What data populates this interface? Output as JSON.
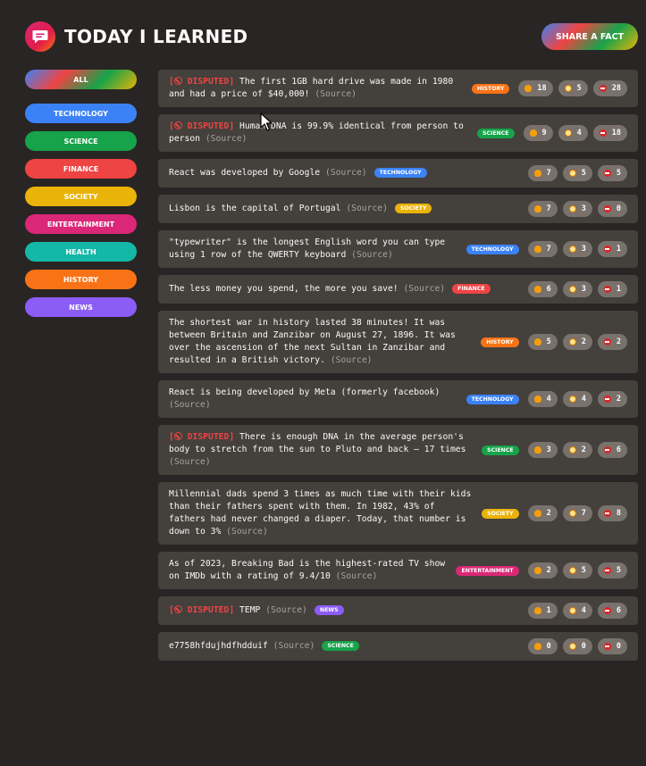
{
  "header": {
    "title": "Today I Learned",
    "share_label": "Share a fact",
    "logo_icon": "speech-bubble-icon"
  },
  "colors": {
    "background": "#292524",
    "card": "#44403c",
    "vote_button": "#78716c",
    "disputed": "#ef4444"
  },
  "categories": [
    {
      "id": "all",
      "label": "All",
      "color": "gradient"
    },
    {
      "id": "technology",
      "label": "Technology",
      "color": "#3b82f6"
    },
    {
      "id": "science",
      "label": "Science",
      "color": "#16a34a"
    },
    {
      "id": "finance",
      "label": "Finance",
      "color": "#ef4444"
    },
    {
      "id": "society",
      "label": "Society",
      "color": "#eab308"
    },
    {
      "id": "entertainment",
      "label": "Entertainment",
      "color": "#db2777"
    },
    {
      "id": "health",
      "label": "Health",
      "color": "#14b8a6"
    },
    {
      "id": "history",
      "label": "History",
      "color": "#f97316"
    },
    {
      "id": "news",
      "label": "News",
      "color": "#8b5cf6"
    }
  ],
  "disputed_label": "DISPUTED",
  "source_label": "(Source)",
  "vote_icons": [
    "thumbs-up-icon",
    "mind-blown-icon",
    "no-entry-icon"
  ],
  "facts": [
    {
      "disputed": true,
      "text": "The first 1GB hard drive was made in 1980 and had a price of $40,000!",
      "category": "history",
      "tag_inline": false,
      "votes": [
        18,
        5,
        28
      ]
    },
    {
      "disputed": true,
      "text": "Human DNA is 99.9% identical from person to person",
      "category": "science",
      "tag_inline": false,
      "votes": [
        9,
        4,
        18
      ]
    },
    {
      "disputed": false,
      "text": "React was developed by Google",
      "category": "technology",
      "tag_inline": true,
      "votes": [
        7,
        5,
        5
      ]
    },
    {
      "disputed": false,
      "text": "Lisbon is the capital of Portugal",
      "category": "society",
      "tag_inline": true,
      "votes": [
        7,
        3,
        0
      ]
    },
    {
      "disputed": false,
      "text": "\"typewriter\" is the longest English word you can type using 1 row of the QWERTY keyboard",
      "category": "technology",
      "tag_inline": false,
      "votes": [
        7,
        3,
        1
      ]
    },
    {
      "disputed": false,
      "text": "The less money you spend, the more you save!",
      "category": "finance",
      "tag_inline": true,
      "votes": [
        6,
        3,
        1
      ]
    },
    {
      "disputed": false,
      "text": "The shortest war in history lasted 38 minutes! It was between Britain and Zanzibar on August 27, 1896. It was over the ascension of the next Sultan in Zanzibar and resulted in a British victory.",
      "category": "history",
      "tag_inline": false,
      "votes": [
        5,
        2,
        2
      ]
    },
    {
      "disputed": false,
      "text": "React is being developed by Meta (formerly facebook)",
      "category": "technology",
      "tag_inline": false,
      "votes": [
        4,
        4,
        2
      ]
    },
    {
      "disputed": true,
      "text": "There is enough DNA in the average person's body to stretch from the sun to Pluto and back — 17 times",
      "category": "science",
      "tag_inline": false,
      "votes": [
        3,
        2,
        6
      ]
    },
    {
      "disputed": false,
      "text": "Millennial dads spend 3 times as much time with their kids than their fathers spent with them. In 1982, 43% of fathers had never changed a diaper. Today, that number is down to 3%",
      "category": "society",
      "tag_inline": false,
      "votes": [
        2,
        7,
        8
      ]
    },
    {
      "disputed": false,
      "text": "As of 2023, Breaking Bad is the highest-rated TV show on IMDb with a rating of 9.4/10",
      "category": "entertainment",
      "tag_inline": false,
      "votes": [
        2,
        5,
        5
      ]
    },
    {
      "disputed": true,
      "text": "TEMP",
      "category": "news",
      "tag_inline": true,
      "votes": [
        1,
        4,
        6
      ]
    },
    {
      "disputed": false,
      "text": "e7758hfdujhdfhdduif",
      "category": "science",
      "tag_inline": true,
      "votes": [
        0,
        0,
        0
      ]
    }
  ]
}
